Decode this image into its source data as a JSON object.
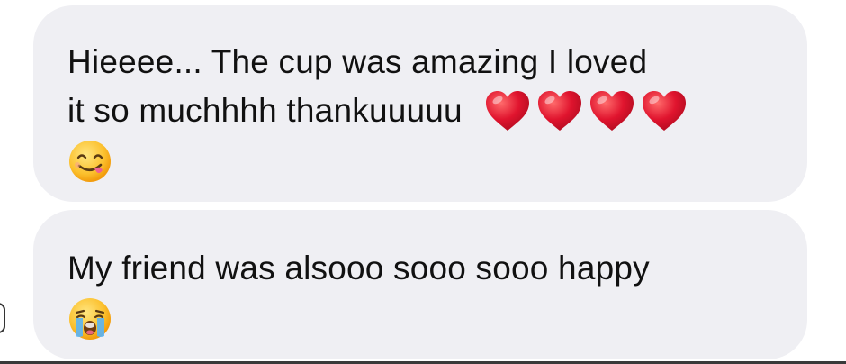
{
  "messages": [
    {
      "line1": "Hieeee... The cup was amazing I loved",
      "line2": "it so muchhhh thankuuuuu",
      "trailing_emojis": [
        "heart-icon",
        "heart-icon",
        "heart-icon",
        "heart-icon"
      ],
      "line3_emoji": "face-savoring-food-icon"
    },
    {
      "line1": "My friend was alsooo sooo sooo happy",
      "line2_emoji": "loudly-crying-face-icon"
    }
  ],
  "colors": {
    "bubble_bg": "#efeff3",
    "text": "#111111",
    "heart": "#e0142e",
    "emoji_yellow": "#fbc02d"
  }
}
